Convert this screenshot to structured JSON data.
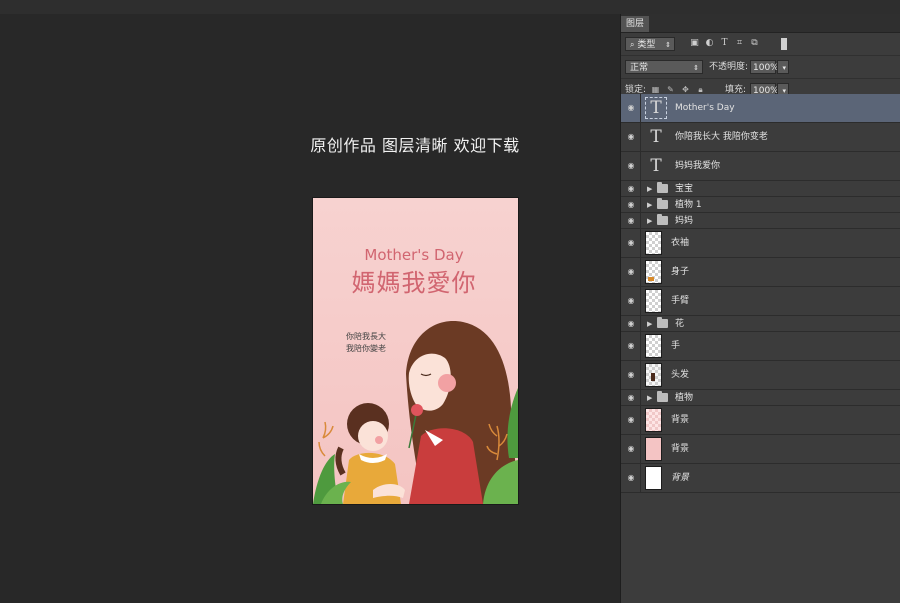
{
  "canvas": {
    "promo_text": "原创作品 图层清晰 欢迎下载",
    "artwork": {
      "title_en": "Mother's Day",
      "title_cn": "媽媽我愛你",
      "subtitle_line1": "你陪我長大",
      "subtitle_line2": "我陪你變老"
    }
  },
  "layers_panel": {
    "tab_label": "图层",
    "filter": {
      "icon": "search-icon",
      "kind_label": "类型"
    },
    "filter_icons": [
      "image-filter-icon",
      "adjustment-filter-icon",
      "type-filter-icon",
      "shape-filter-icon",
      "smart-object-filter-icon",
      "filter-toggle-icon"
    ],
    "blend_mode": "正常",
    "opacity_label": "不透明度:",
    "opacity_value": "100%",
    "lock_label": "锁定:",
    "lock_icons": [
      "lock-transparent-icon",
      "lock-pixels-icon",
      "lock-position-icon",
      "lock-all-icon"
    ],
    "fill_label": "填充:",
    "fill_value": "100%",
    "layers": [
      {
        "name": "Mother's Day",
        "kind": "text",
        "selected": true
      },
      {
        "name": "你陪我长大 我陪你变老",
        "kind": "text"
      },
      {
        "name": "妈妈我爱你",
        "kind": "text"
      },
      {
        "name": "宝宝",
        "kind": "group"
      },
      {
        "name": "植物 1",
        "kind": "group"
      },
      {
        "name": "妈妈",
        "kind": "group"
      },
      {
        "name": "衣袖",
        "kind": "pixel"
      },
      {
        "name": "身子",
        "kind": "pixel"
      },
      {
        "name": "手臂",
        "kind": "pixel"
      },
      {
        "name": "花",
        "kind": "group"
      },
      {
        "name": "手",
        "kind": "pixel"
      },
      {
        "name": "头发",
        "kind": "pixel"
      },
      {
        "name": "植物",
        "kind": "group"
      },
      {
        "name": "背景",
        "kind": "pixel"
      },
      {
        "name": "背景",
        "kind": "pixel"
      },
      {
        "name": "背景",
        "kind": "pixel",
        "italic": true
      }
    ]
  }
}
